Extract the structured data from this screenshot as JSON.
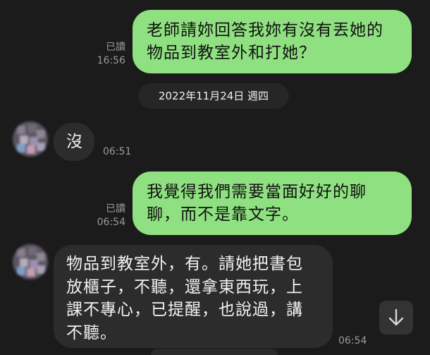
{
  "messages": [
    {
      "side": "out",
      "lines": [
        "老師請妳回答我妳有沒有丟她的",
        "物品到教室外和打她？"
      ],
      "read": "已讀",
      "time": "16:56"
    },
    {
      "side": "in",
      "lines": [
        "沒"
      ],
      "time": "06:51"
    },
    {
      "side": "out",
      "lines": [
        "我覺得我們需要當面好好的聊",
        "聊，而不是靠文字。"
      ],
      "read": "已讀",
      "time": "06:54"
    },
    {
      "side": "in",
      "lines": [
        "物品到教室外，有。請她把書包",
        "放櫃子，不聽，還拿東西玩，上",
        "課不專心，已提醒，也說過，講",
        "不聽。"
      ],
      "time": "06:54"
    }
  ],
  "date_divider": "2022年11月24日 週四",
  "colors": {
    "background": "#1b1b1b",
    "outgoing_bubble": "#8fe080",
    "incoming_bubble": "#2c2c2c"
  },
  "icons": {
    "scroll_down": "arrow-down-icon"
  }
}
